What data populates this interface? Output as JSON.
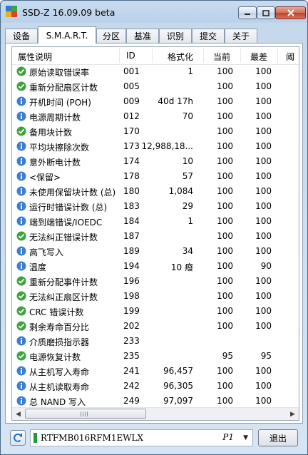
{
  "window": {
    "title": "SSD-Z 16.09.09 beta"
  },
  "tabs": [
    {
      "label": "设备",
      "active": false
    },
    {
      "label": "S.M.A.R.T.",
      "active": true
    },
    {
      "label": "分区",
      "active": false
    },
    {
      "label": "基准",
      "active": false
    },
    {
      "label": "识别",
      "active": false
    },
    {
      "label": "提交",
      "active": false
    },
    {
      "label": "关于",
      "active": false
    }
  ],
  "smart_table": {
    "columns": [
      "属性说明",
      "ID",
      "格式化",
      "当前",
      "最差",
      "阈"
    ],
    "rows": [
      {
        "status": "ok",
        "name": "原始读取错误率",
        "id": "001",
        "formatted": "1",
        "current": "100",
        "worst": "100"
      },
      {
        "status": "ok",
        "name": "重新分配扇区计数",
        "id": "005",
        "formatted": "",
        "current": "100",
        "worst": "100"
      },
      {
        "status": "info",
        "name": "开机时间 (POH)",
        "id": "009",
        "formatted": "40d 17h",
        "current": "100",
        "worst": "100"
      },
      {
        "status": "info",
        "name": "电源周期计数",
        "id": "012",
        "formatted": "70",
        "current": "100",
        "worst": "100"
      },
      {
        "status": "ok",
        "name": "备用块计数",
        "id": "170",
        "formatted": "",
        "current": "100",
        "worst": "100"
      },
      {
        "status": "info",
        "name": "平均块擦除次数",
        "id": "173",
        "formatted": "12,988,18...",
        "current": "100",
        "worst": "100"
      },
      {
        "status": "info",
        "name": "意外断电计数",
        "id": "174",
        "formatted": "10",
        "current": "100",
        "worst": "100"
      },
      {
        "status": "info",
        "name": "<保留>",
        "id": "178",
        "formatted": "57",
        "current": "100",
        "worst": "100"
      },
      {
        "status": "info",
        "name": "未使用保留块计数 (总)",
        "id": "180",
        "formatted": "1,084",
        "current": "100",
        "worst": "100"
      },
      {
        "status": "info",
        "name": "运行时错误计数 (总)",
        "id": "183",
        "formatted": "29",
        "current": "100",
        "worst": "100"
      },
      {
        "status": "info",
        "name": "端到端错误/IOEDC",
        "id": "184",
        "formatted": "1",
        "current": "100",
        "worst": "100"
      },
      {
        "status": "ok",
        "name": "无法纠正错误计数",
        "id": "187",
        "formatted": "",
        "current": "100",
        "worst": "100"
      },
      {
        "status": "info",
        "name": "高飞写入",
        "id": "189",
        "formatted": "34",
        "current": "100",
        "worst": "100"
      },
      {
        "status": "info",
        "name": "温度",
        "id": "194",
        "formatted": "10 癈",
        "current": "100",
        "worst": "90"
      },
      {
        "status": "ok",
        "name": "重新分配事件计数",
        "id": "196",
        "formatted": "",
        "current": "100",
        "worst": "100"
      },
      {
        "status": "ok",
        "name": "无法纠正扇区计数",
        "id": "198",
        "formatted": "",
        "current": "100",
        "worst": "100"
      },
      {
        "status": "ok",
        "name": "CRC 错误计数",
        "id": "199",
        "formatted": "",
        "current": "100",
        "worst": "100"
      },
      {
        "status": "ok",
        "name": "剩余寿命百分比",
        "id": "202",
        "formatted": "",
        "current": "100",
        "worst": "100"
      },
      {
        "status": "info",
        "name": "介质磨损指示器",
        "id": "233",
        "formatted": "",
        "current": "",
        "worst": ""
      },
      {
        "status": "ok",
        "name": "电源恢复计数",
        "id": "235",
        "formatted": "",
        "current": "95",
        "worst": "95"
      },
      {
        "status": "info",
        "name": "从主机写入寿命",
        "id": "241",
        "formatted": "96,457",
        "current": "100",
        "worst": "100"
      },
      {
        "status": "info",
        "name": "从主机读取寿命",
        "id": "242",
        "formatted": "96,305",
        "current": "100",
        "worst": "100"
      },
      {
        "status": "info",
        "name": "总 NAND 写入",
        "id": "249",
        "formatted": "97,097",
        "current": "100",
        "worst": "100"
      }
    ]
  },
  "footer": {
    "drive_name": "RTFMB016RFM1EWLX",
    "drive_port": "P1",
    "exit_label": "退出"
  },
  "colors": {
    "ok": "#3aa53a",
    "info": "#3b7fd0",
    "drive": "#1f9a3a"
  }
}
